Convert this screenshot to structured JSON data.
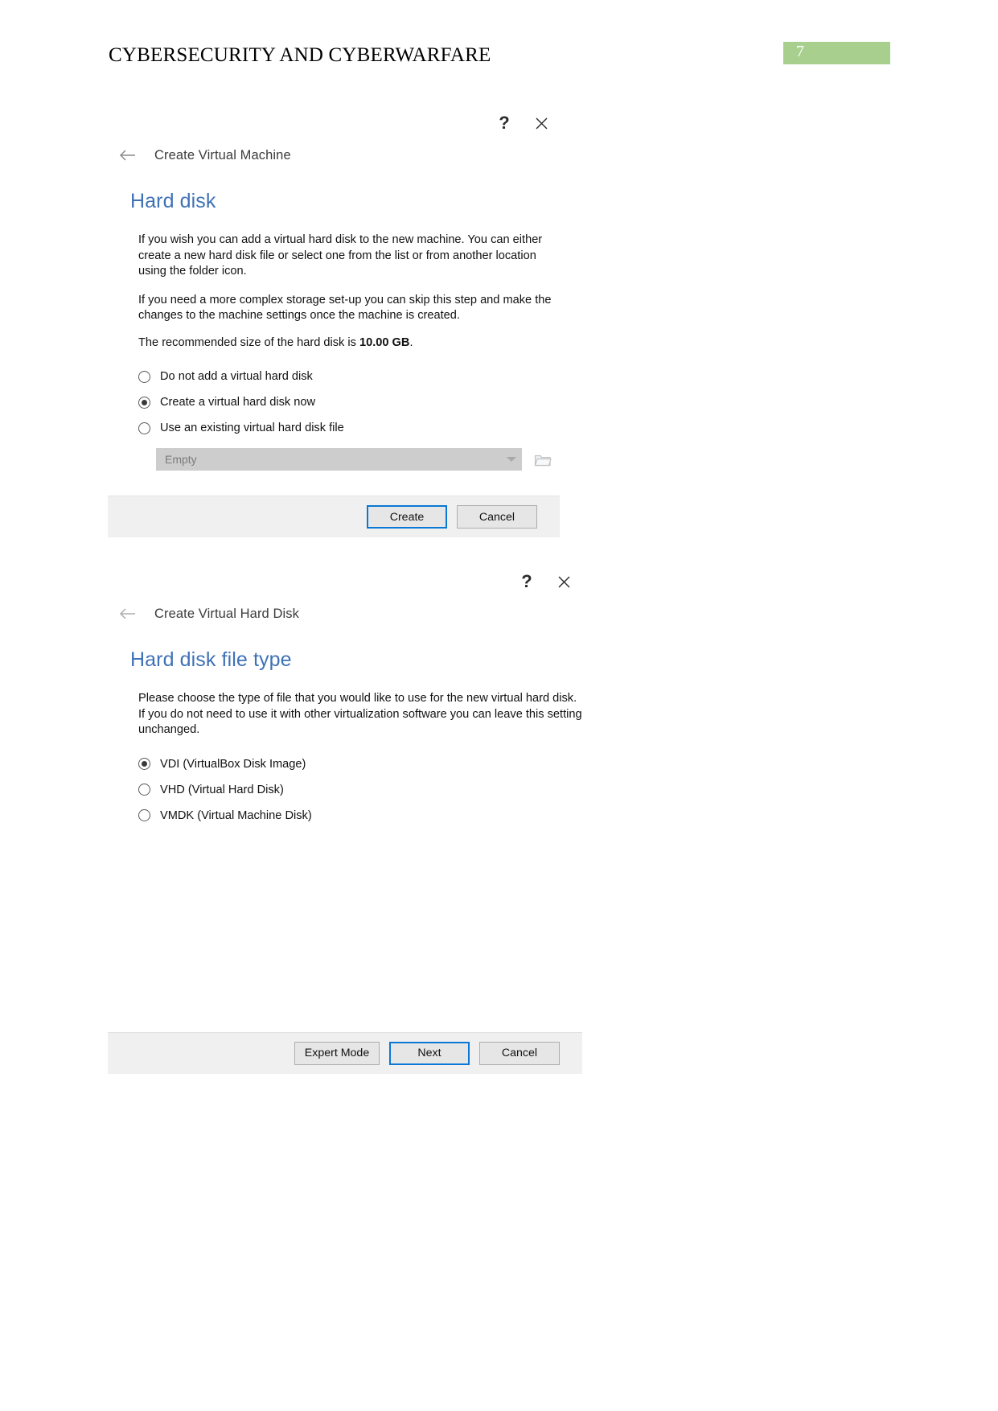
{
  "page": {
    "document_title": "CYBERSECURITY AND CYBERWARFARE",
    "page_number": "7",
    "badge_color": "#a8cf8e",
    "accent_blue": "#3f72b5",
    "focus_blue": "#0a78d4"
  },
  "dialog_one": {
    "nav_title": "Create Virtual Machine",
    "help_icon": "question-mark-icon",
    "close_icon": "close-icon",
    "back_icon": "back-arrow-icon",
    "heading": "Hard disk",
    "paragraph_1": "If you wish you can add a virtual hard disk to the new machine. You can either create a new hard disk file or select one from the list or from another location using the folder icon.",
    "paragraph_2": "If you need a more complex storage set-up you can skip this step and make the changes to the machine settings once the machine is created.",
    "recommended_prefix": "The recommended size of the hard disk is ",
    "recommended_value": "10.00 GB",
    "recommended_suffix": ".",
    "options": [
      {
        "label": "Do not add a virtual hard disk",
        "selected": false
      },
      {
        "label": "Create a virtual hard disk now",
        "selected": true
      },
      {
        "label": "Use an existing virtual hard disk file",
        "selected": false
      }
    ],
    "combo": {
      "value": "Empty",
      "enabled": false,
      "arrow_icon": "chevron-down-icon",
      "browse_icon": "folder-icon"
    },
    "buttons": {
      "create": "Create",
      "cancel": "Cancel"
    }
  },
  "dialog_two": {
    "nav_title": "Create Virtual Hard Disk",
    "help_icon": "question-mark-icon",
    "close_icon": "close-icon",
    "back_icon": "back-arrow-icon",
    "heading": "Hard disk file type",
    "paragraph_1": "Please choose the type of file that you would like to use for the new virtual hard disk. If you do not need to use it with other virtualization software you can leave this setting unchanged.",
    "options": [
      {
        "label": "VDI (VirtualBox Disk Image)",
        "selected": true
      },
      {
        "label": "VHD (Virtual Hard Disk)",
        "selected": false
      },
      {
        "label": "VMDK (Virtual Machine Disk)",
        "selected": false
      }
    ],
    "buttons": {
      "expert_mode": "Expert Mode",
      "next": "Next",
      "cancel": "Cancel"
    }
  }
}
